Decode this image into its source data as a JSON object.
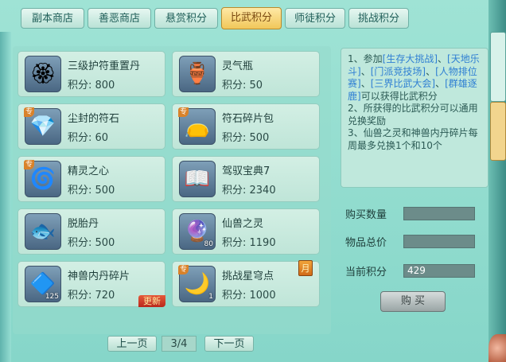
{
  "tabs": [
    {
      "label": "副本商店",
      "active": false
    },
    {
      "label": "善恶商店",
      "active": false
    },
    {
      "label": "悬赏积分",
      "active": false
    },
    {
      "label": "比武积分",
      "active": true
    },
    {
      "label": "师徒积分",
      "active": false
    },
    {
      "label": "挑战积分",
      "active": false
    }
  ],
  "items": [
    {
      "name": "三级护符重置丹",
      "price": "积分: 800",
      "icon": "gold-medallion-icon",
      "glyph": "🏵",
      "qty": "",
      "tag": "",
      "badge": ""
    },
    {
      "name": "灵气瓶",
      "price": "积分: 50",
      "icon": "vase-icon",
      "glyph": "🏺",
      "qty": "",
      "tag": "",
      "badge": ""
    },
    {
      "name": "尘封的符石",
      "price": "积分: 60",
      "icon": "crystal-stone-icon",
      "glyph": "💎",
      "qty": "",
      "tag": "专",
      "badge": ""
    },
    {
      "name": "符石碎片包",
      "price": "积分: 500",
      "icon": "red-bag-icon",
      "glyph": "👝",
      "qty": "",
      "tag": "专",
      "badge": ""
    },
    {
      "name": "精灵之心",
      "price": "积分: 500",
      "icon": "spirit-heart-icon",
      "glyph": "🌀",
      "qty": "",
      "tag": "专",
      "badge": ""
    },
    {
      "name": "驾驭宝典7",
      "price": "积分: 2340",
      "icon": "open-book-icon",
      "glyph": "📖",
      "qty": "",
      "tag": "",
      "badge": ""
    },
    {
      "name": "脱胎丹",
      "price": "积分: 500",
      "icon": "blue-fish-pill-icon",
      "glyph": "🐟",
      "qty": "",
      "tag": "",
      "badge": ""
    },
    {
      "name": "仙兽之灵",
      "price": "积分: 1190",
      "icon": "blue-orb-icon",
      "glyph": "🔮",
      "qty": "80",
      "tag": "",
      "badge": ""
    },
    {
      "name": "神兽内丹碎片",
      "price": "积分: 720",
      "icon": "purple-crystal-icon",
      "glyph": "🔷",
      "qty": "125",
      "tag": "",
      "badge": "更新"
    },
    {
      "name": "挑战星穹点",
      "price": "积分: 1000",
      "icon": "crescent-moon-icon",
      "glyph": "🌙",
      "qty": "1",
      "tag": "专",
      "badge": "月"
    }
  ],
  "info": {
    "line1_prefix": "1、参加",
    "events": [
      "[生存大挑战]",
      "[天地乐斗]",
      "[门派竞技场]",
      "[人物排位赛]",
      "[三界比武大会]",
      "[群雄逐鹿]"
    ],
    "line1_suffix": "可以获得比武积分",
    "line2": "2、所获得的比武积分可以通用兑换奖励",
    "line3": "3、仙兽之灵和神兽内丹碎片每周最多兑换1个和10个"
  },
  "form": {
    "qty_label": "购买数量",
    "qty_value": "",
    "total_label": "物品总价",
    "total_value": "",
    "points_label": "当前积分",
    "points_value": "429",
    "buy_label": "购 买"
  },
  "pager": {
    "prev": "上一页",
    "page": "3/4",
    "next": "下一页"
  }
}
